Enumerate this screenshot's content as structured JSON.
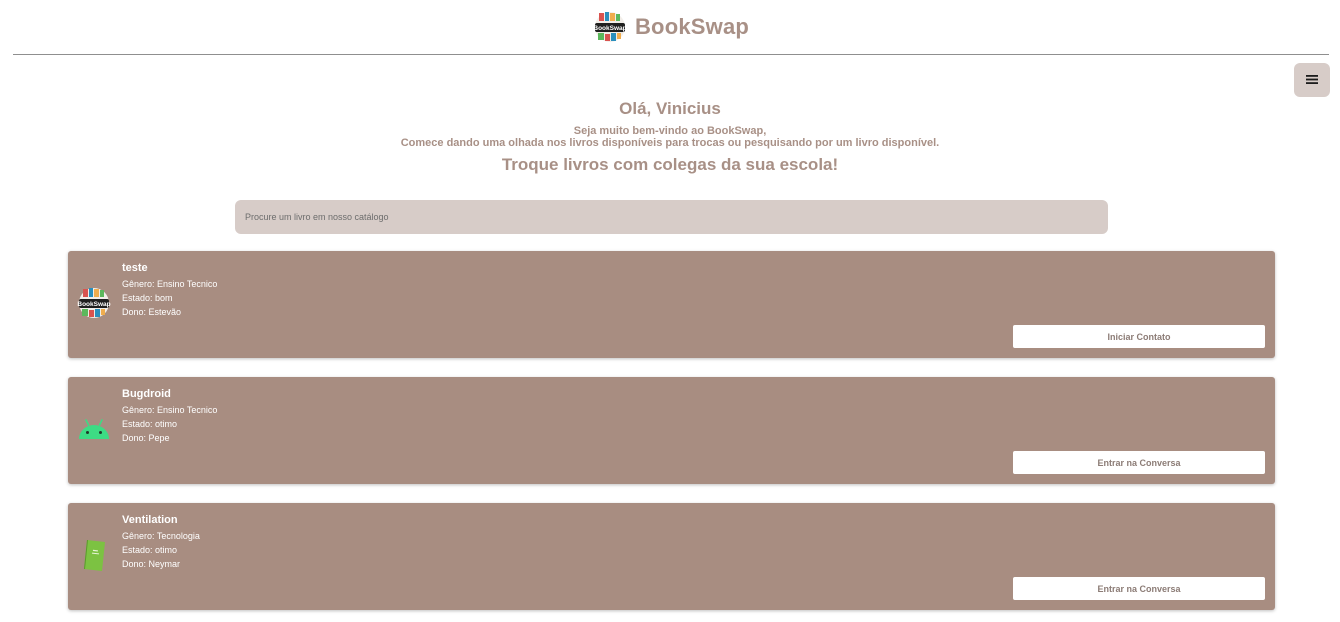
{
  "header": {
    "brand_name": "BookSwap",
    "logo_text": "BookSwap",
    "logo_icon": "bookswap-logo"
  },
  "menu": {
    "icon": "hamburger-menu-icon"
  },
  "hero": {
    "greeting": "Olá, Vinicius",
    "welcome_line1": "Seja muito bem-vindo ao BookSwap,",
    "welcome_line2": "Comece dando uma olhada nos livros disponíveis para trocas ou pesquisando por um livro disponível.",
    "tagline": "Troque livros com colegas da sua escola!"
  },
  "search": {
    "placeholder": "Procure um livro em nosso catálogo",
    "value": ""
  },
  "books": [
    {
      "title": "teste",
      "genre": "Gênero: Ensino Tecnico",
      "state": "Estado: bom",
      "owner": "Dono: Estevão",
      "button_label": "Iniciar Contato",
      "thumb_icon": "bookswap-logo"
    },
    {
      "title": "Bugdroid",
      "genre": "Gênero: Ensino Tecnico",
      "state": "Estado: otimo",
      "owner": "Dono: Pepe",
      "button_label": "Entrar na Conversa",
      "thumb_icon": "android-icon"
    },
    {
      "title": "Ventilation",
      "genre": "Gênero: Tecnologia",
      "state": "Estado: otimo",
      "owner": "Dono: Neymar",
      "button_label": "Entrar na Conversa",
      "thumb_icon": "green-book-icon"
    }
  ],
  "colors": {
    "accent_text": "#a89086",
    "card_bg": "#a88d81",
    "input_bg": "#d7ccc8",
    "android_green": "#3ddc84",
    "book_green": "#7cc242"
  }
}
